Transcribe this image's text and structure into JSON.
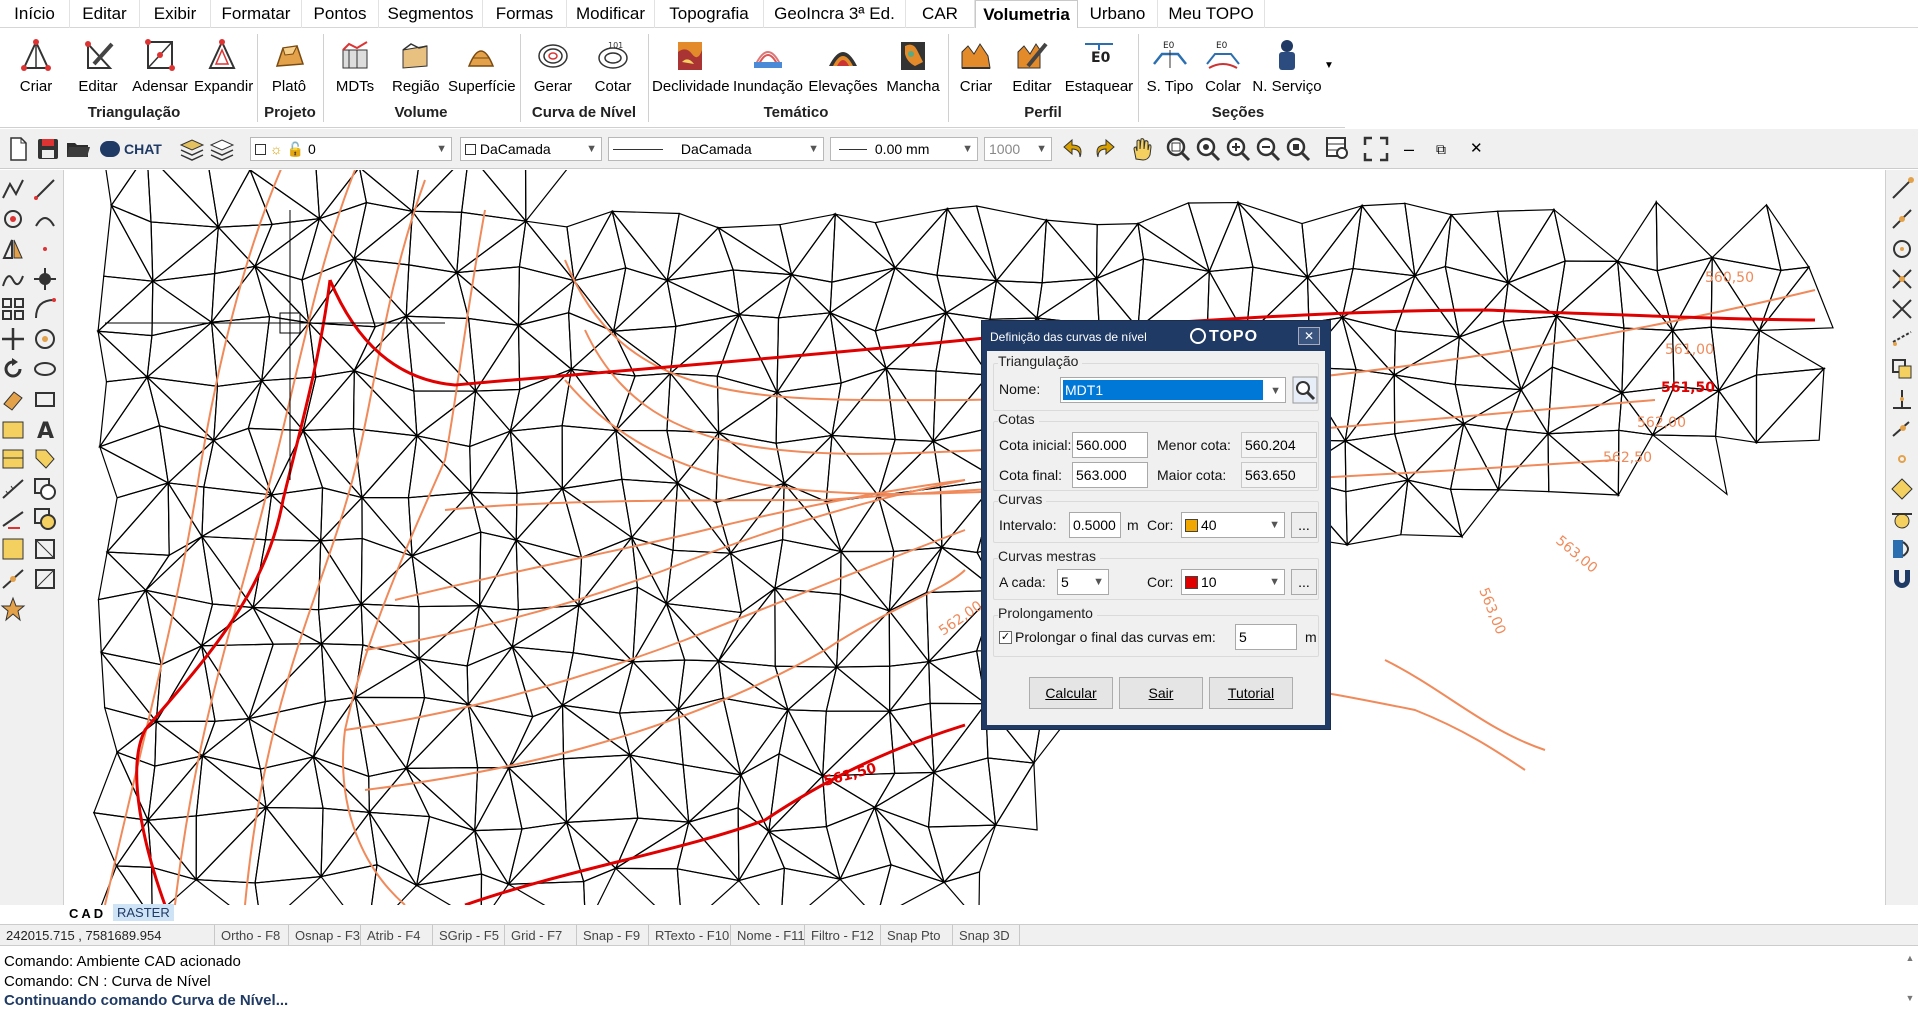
{
  "menu": {
    "tabs": [
      "Início",
      "Editar",
      "Exibir",
      "Formatar",
      "Pontos",
      "Segmentos",
      "Formas",
      "Modificar",
      "Topografia",
      "GeoIncra 3ª Ed.",
      "CAR",
      "Volumetria",
      "Urbano",
      "Meu TOPO"
    ],
    "active_tab": "Volumetria"
  },
  "ribbon": {
    "groups": {
      "triangulacao": {
        "label": "Triangulação",
        "buttons": [
          "Criar",
          "Editar",
          "Adensar",
          "Expandir"
        ]
      },
      "projeto": {
        "label": "Projeto",
        "buttons": [
          "Platô"
        ]
      },
      "volume": {
        "label": "Volume",
        "buttons": [
          "MDTs",
          "Região",
          "Superfície"
        ]
      },
      "curva": {
        "label": "Curva de Nível",
        "buttons": [
          "Gerar",
          "Cotar"
        ]
      },
      "tematico": {
        "label": "Temático",
        "buttons": [
          "Declividade",
          "Inundação",
          "Elevações",
          "Mancha"
        ]
      },
      "perfil": {
        "label": "Perfil",
        "buttons": [
          "Criar",
          "Editar",
          "Estaquear"
        ]
      },
      "secoes": {
        "label": "Seções",
        "buttons": [
          "S. Tipo",
          "Colar",
          "N. Serviço"
        ]
      }
    }
  },
  "toolbar": {
    "chat_label": "CHAT",
    "layer_value": "0",
    "color_value": "DaCamada",
    "linetype_value": "DaCamada",
    "lineweight_value": "0.00 mm",
    "scale_value": "1000"
  },
  "canvas": {
    "contour_labels": [
      "560,50",
      "561,00",
      "561,50",
      "562,00",
      "562,50",
      "563,00",
      "563,00",
      "562,00",
      "561,50"
    ]
  },
  "cad_tabs": [
    "CAD",
    "RASTER"
  ],
  "status": {
    "coords": "242015.715 , 7581689.954",
    "toggles": [
      "Ortho - F8",
      "Osnap - F3",
      "Atrib - F4",
      "SGrip - F5",
      "Grid - F7",
      "Snap - F9",
      "RTexto - F10",
      "Nome - F11",
      "Filtro - F12",
      "Snap Pto",
      "Snap 3D"
    ]
  },
  "command": {
    "lines": [
      "Comando: Ambiente CAD acionado",
      "Comando: CN : Curva de Nível",
      "Continuando comando Curva de Nível..."
    ]
  },
  "dialog": {
    "title": "Definição das curvas de nível",
    "logo": "TOPO",
    "close": "✕",
    "triangulacao": {
      "group": "Triangulação",
      "nome_label": "Nome:",
      "nome_value": "MDT1"
    },
    "cotas": {
      "group": "Cotas",
      "inicial_label": "Cota inicial:",
      "inicial_value": "560.000",
      "final_label": "Cota final:",
      "final_value": "563.000",
      "menor_label": "Menor cota:",
      "menor_value": "560.204",
      "maior_label": "Maior cota:",
      "maior_value": "563.650"
    },
    "curvas": {
      "group": "Curvas",
      "intervalo_label": "Intervalo:",
      "intervalo_value": "0.5000",
      "unit": "m",
      "cor_label": "Cor:",
      "cor_value": "40",
      "cor_hex": "#f0a800",
      "more": "..."
    },
    "mestras": {
      "group": "Curvas mestras",
      "acada_label": "A cada:",
      "acada_value": "5",
      "cor_label": "Cor:",
      "cor_value": "10",
      "cor_hex": "#e00000",
      "more": "..."
    },
    "prolongamento": {
      "group": "Prolongamento",
      "check_label": "Prolongar o final das curvas em:",
      "value": "5",
      "unit": "m",
      "checked": true
    },
    "buttons": {
      "calcular": "Calcular",
      "sair": "Sair",
      "tutorial": "Tutorial"
    }
  }
}
